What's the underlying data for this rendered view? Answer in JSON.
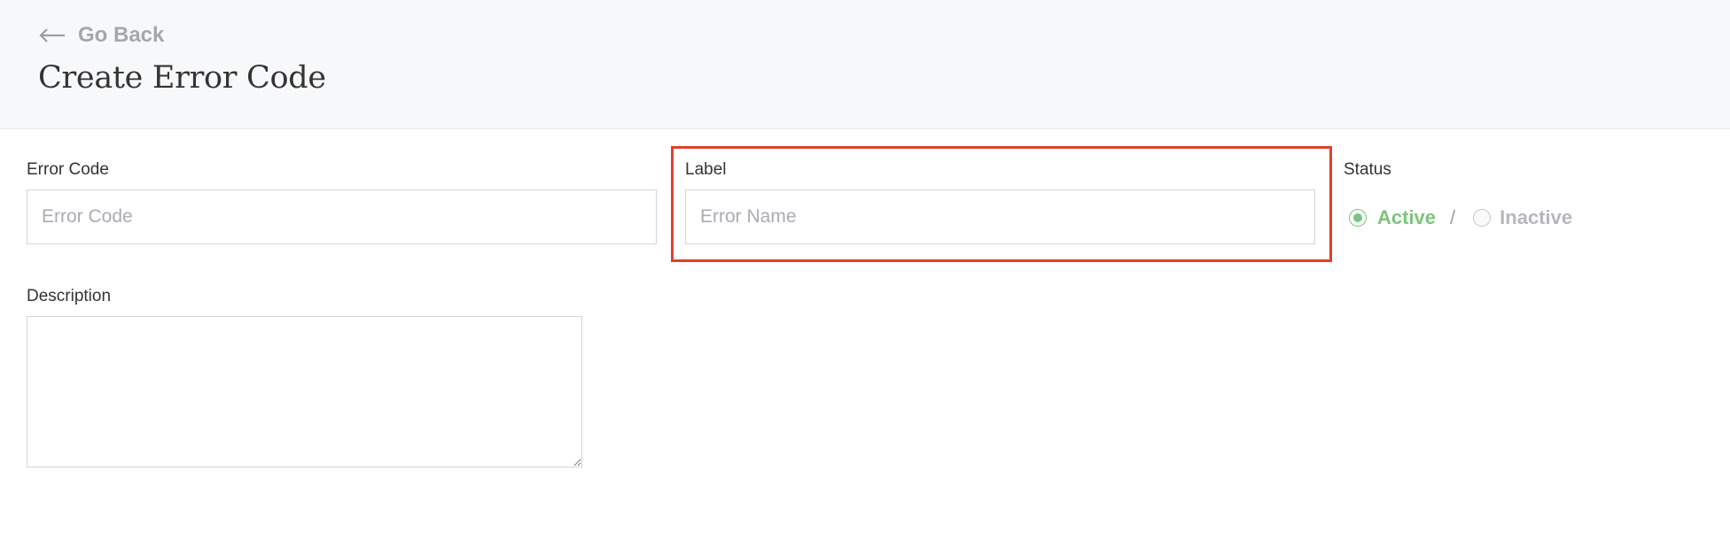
{
  "header": {
    "go_back_label": "Go Back",
    "title": "Create Error Code"
  },
  "form": {
    "error_code": {
      "label": "Error Code",
      "placeholder": "Error Code",
      "value": ""
    },
    "label_field": {
      "label": "Label",
      "placeholder": "Error Name",
      "value": ""
    },
    "status": {
      "label": "Status",
      "options": [
        {
          "label": "Active",
          "selected": true
        },
        {
          "label": "Inactive",
          "selected": false
        }
      ],
      "separator": "/"
    },
    "description": {
      "label": "Description",
      "value": ""
    }
  },
  "colors": {
    "header_bg": "#f7f8fa",
    "active_green": "#7cc47f",
    "highlight_red": "#e0412c",
    "muted_gray": "#a3a7ae"
  },
  "icons": {
    "back": "arrow-left-icon",
    "resize": "resize-grip-icon"
  }
}
